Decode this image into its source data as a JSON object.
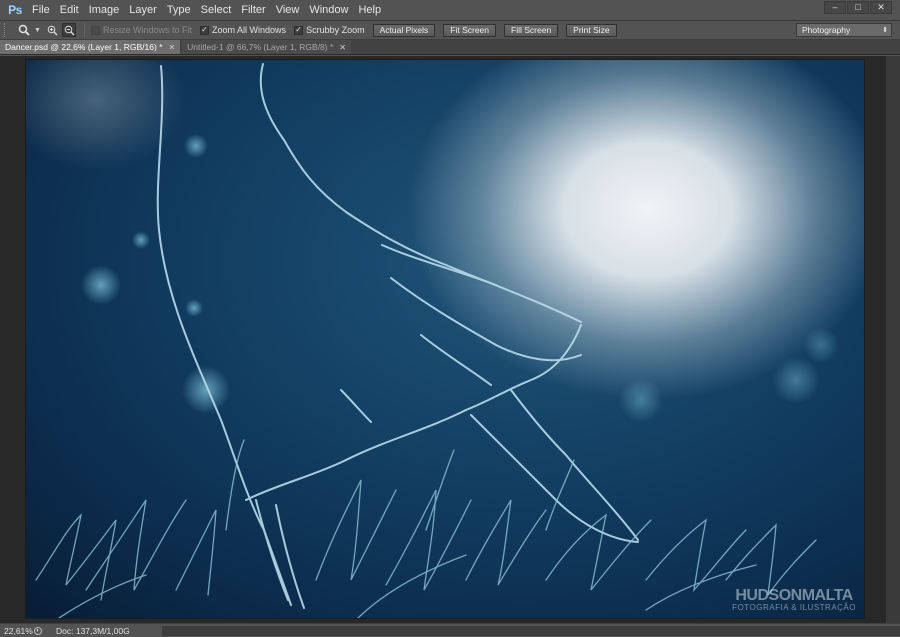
{
  "app": {
    "logo": "Ps"
  },
  "menu": [
    "File",
    "Edit",
    "Image",
    "Layer",
    "Type",
    "Select",
    "Filter",
    "View",
    "Window",
    "Help"
  ],
  "window_controls": {
    "minimize": "–",
    "maximize": "□",
    "close": "✕"
  },
  "options": {
    "tool_icon": "zoom-icon",
    "resize_windows": {
      "label": "Resize Windows to Fit",
      "checked": false,
      "enabled": false
    },
    "zoom_all": {
      "label": "Zoom All Windows",
      "checked": true
    },
    "scrubby": {
      "label": "Scrubby Zoom",
      "checked": true
    },
    "buttons": [
      "Actual Pixels",
      "Fit Screen",
      "Fill Screen",
      "Print Size"
    ],
    "workspace": "Photography"
  },
  "tabs": [
    {
      "label": "Dancer.psd @ 22,6% (Layer 1, RGB/16) *",
      "active": true
    },
    {
      "label": "Untitled-1 @ 66,7% (Layer 1, RGB/8) *",
      "active": false
    }
  ],
  "watermark": {
    "name": "HUDSONMALTA",
    "subtitle": "FOTOGRAFIA & ILUSTRAÇÃO"
  },
  "status": {
    "zoom": "22,61%",
    "doc": "Doc: 137,3M/1,00G"
  },
  "colors": {
    "ui_bg": "#535353",
    "canvas_bg": "#282828",
    "art_blue": "#123e62",
    "moon": "#e8edf1",
    "sketch": "#a8d4e6"
  }
}
